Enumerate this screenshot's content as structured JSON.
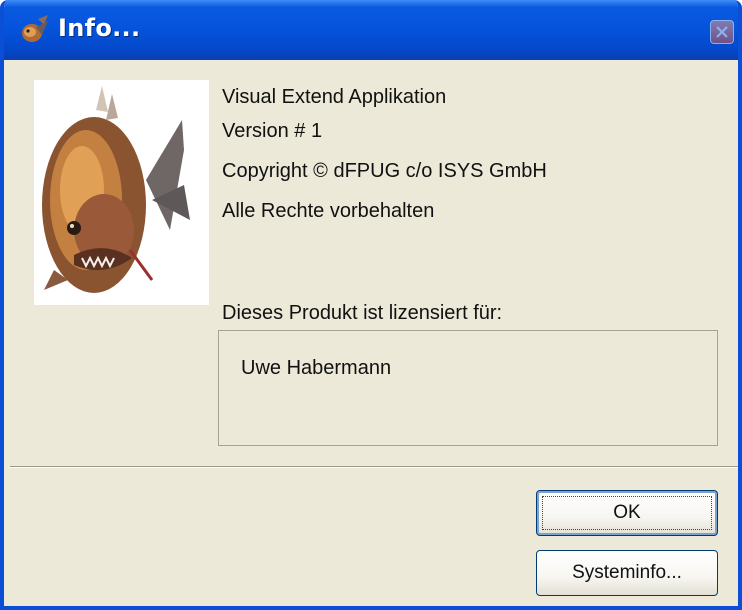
{
  "window": {
    "title": "Info..."
  },
  "about": {
    "lines": [
      "Visual Extend Applikation",
      "Version # 1",
      "Copyright © dFPUG c/o ISYS GmbH",
      "Alle Rechte vorbehalten"
    ],
    "license_label": "Dieses Produkt ist lizensiert für:",
    "licensee": "Uwe Habermann"
  },
  "buttons": {
    "ok": "OK",
    "systeminfo": "Systeminfo..."
  },
  "icons": {
    "title": "fish-icon",
    "close": "close-icon",
    "logo": "fish-logo-image"
  },
  "colors": {
    "titlebar": "#0553db",
    "face": "#ece9d8",
    "button_border": "#003c74"
  }
}
